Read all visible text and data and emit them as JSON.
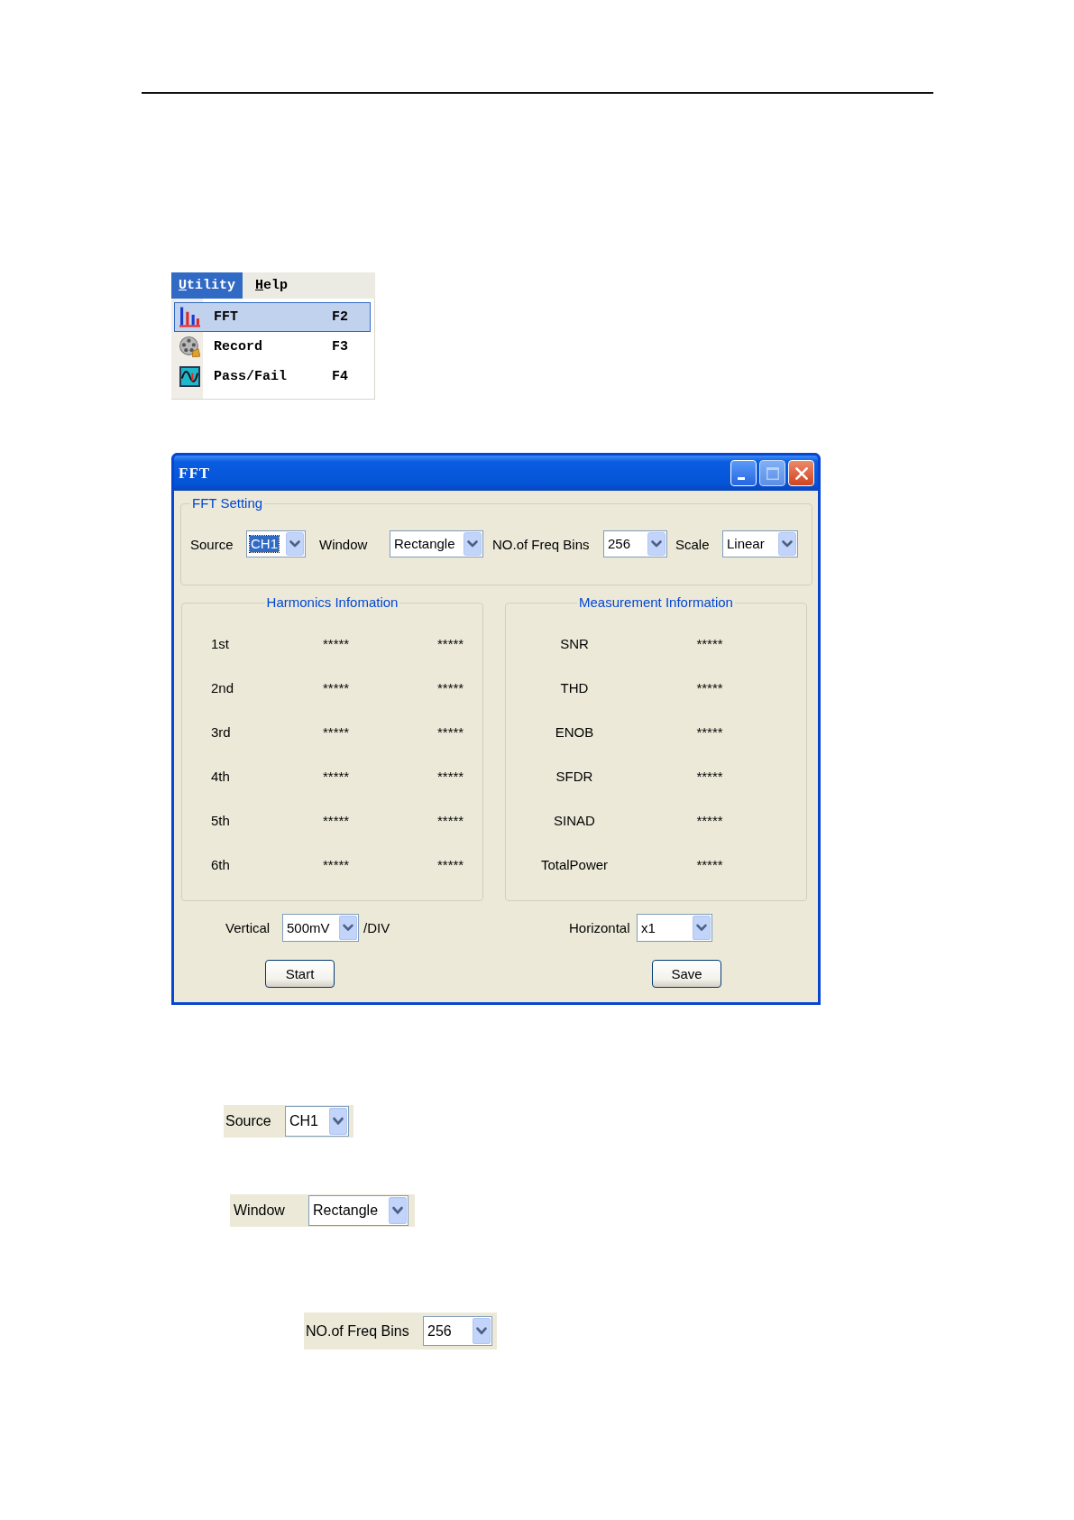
{
  "menu": {
    "bar": [
      {
        "label": "Utility",
        "selected": true
      },
      {
        "label": "Help",
        "selected": false
      }
    ],
    "items": [
      {
        "kind": "fft",
        "label": "FFT",
        "shortcut": "F2",
        "selected": true
      },
      {
        "kind": "record",
        "label": "Record",
        "shortcut": "F3",
        "selected": false
      },
      {
        "kind": "passfail",
        "label": "Pass/Fail",
        "shortcut": "F4",
        "selected": false
      }
    ]
  },
  "dialog": {
    "title": "FFT",
    "window_buttons": [
      {
        "kind": "minimize",
        "disabled": false
      },
      {
        "kind": "maximize",
        "disabled": true
      },
      {
        "kind": "close",
        "disabled": false
      }
    ],
    "fft_setting": {
      "title": "FFT Setting",
      "fields": [
        {
          "label": "Source",
          "value": "CH1",
          "focused": true
        },
        {
          "label": "Window",
          "value": "Rectangle",
          "focused": false
        },
        {
          "label": "NO.of Freq Bins",
          "value": "256",
          "focused": false
        },
        {
          "label": "Scale",
          "value": "Linear",
          "focused": false
        }
      ]
    },
    "harmonics": {
      "title": "Harmonics Infomation",
      "rows": [
        {
          "label": "1st",
          "value_1": "*****",
          "value_2": "*****"
        },
        {
          "label": "2nd",
          "value_1": "*****",
          "value_2": "*****"
        },
        {
          "label": "3rd",
          "value_1": "*****",
          "value_2": "*****"
        },
        {
          "label": "4th",
          "value_1": "*****",
          "value_2": "*****"
        },
        {
          "label": "5th",
          "value_1": "*****",
          "value_2": "*****"
        },
        {
          "label": "6th",
          "value_1": "*****",
          "value_2": "*****"
        }
      ]
    },
    "measurement": {
      "title": "Measurement Information",
      "rows": [
        {
          "label": "SNR",
          "value": "*****"
        },
        {
          "label": "THD",
          "value": "*****"
        },
        {
          "label": "ENOB",
          "value": "*****"
        },
        {
          "label": "SFDR",
          "value": "*****"
        },
        {
          "label": "SINAD",
          "value": "*****"
        },
        {
          "label": "TotalPower",
          "value": "*****"
        }
      ]
    },
    "vertical": {
      "label": "Vertical",
      "value": "500mV",
      "unit": "/DIV"
    },
    "horizontal": {
      "label": "Horizontal",
      "value": "x1"
    },
    "buttons": [
      "Start",
      "Save"
    ]
  },
  "snippets": [
    {
      "label": "Source",
      "value": "CH1"
    },
    {
      "label": "Window",
      "value": "Rectangle"
    },
    {
      "label": "NO.of Freq Bins",
      "value": "256"
    }
  ]
}
